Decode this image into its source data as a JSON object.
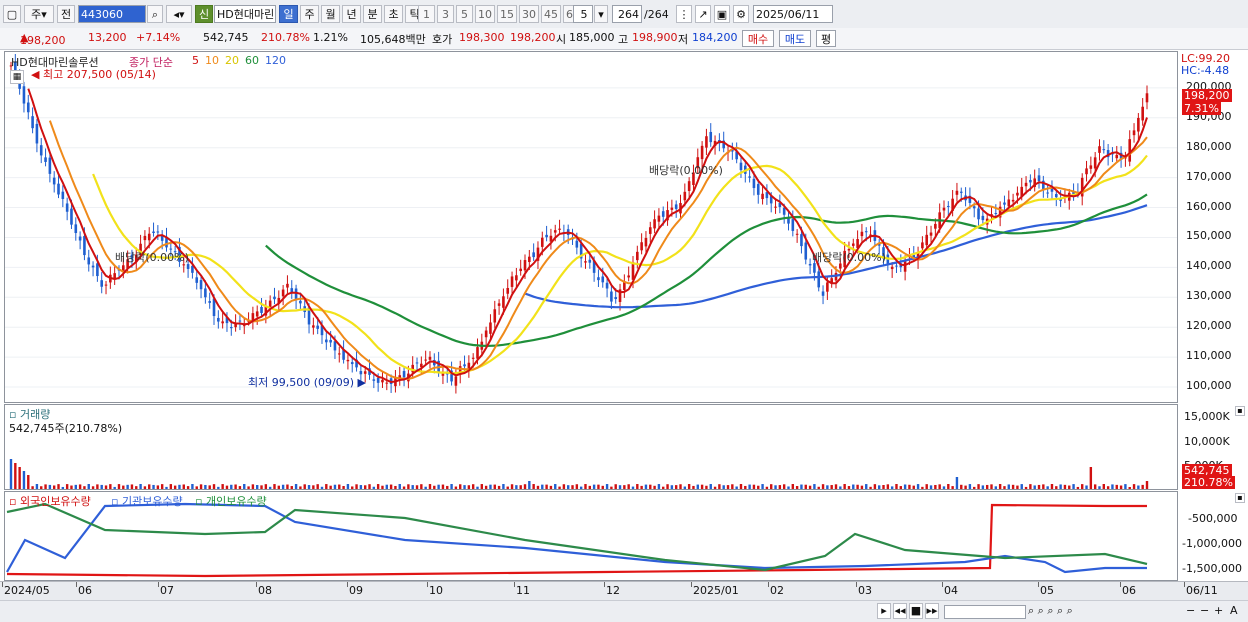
{
  "toolbar": {
    "period_type": "주",
    "prev_label": "전",
    "code": "443060",
    "new_badge": "신",
    "name": "HD현대마린",
    "periods": [
      "일",
      "주",
      "월",
      "년",
      "분",
      "초",
      "틱"
    ],
    "active_period": "일",
    "intervals": [
      "1",
      "3",
      "5",
      "10",
      "15",
      "30",
      "45",
      "60"
    ],
    "custom_interval": "5",
    "count": "264",
    "total": "/264",
    "date": "2025/06/11"
  },
  "info": {
    "price": "198,200",
    "change": "13,200",
    "change_pct": "+7.14%",
    "volume": "542,745",
    "volume_ratio": "210.78%",
    "turnover": "1.21%",
    "amount": "105,648백만",
    "ask_label": "호가",
    "ask": "198,300",
    "bid": "198,200",
    "open_label": "시",
    "open": "185,000",
    "high_label": "고",
    "high": "198,900",
    "low_label": "저",
    "low": "184,200",
    "buy_label": "매수",
    "sell_label": "매도",
    "eval_label": "평"
  },
  "legend": {
    "name": "HD현대마린솔루션",
    "ma_label": "종가 단순",
    "ma5": "5",
    "ma10": "10",
    "ma20": "20",
    "ma60": "60",
    "ma120": "120"
  },
  "annotations": {
    "high": "최고 207,500 (05/14)",
    "low": "최저 99,500 (09/09)",
    "div1": "배당락(0.00%)",
    "div2": "배당락(0.00%)",
    "div3": "배당락(0.00%)"
  },
  "right_info": {
    "lc": "LC:99.20",
    "hc": "HC:-4.48",
    "last": "198,200",
    "last_pct": "7.31%",
    "vol_last": "542,745",
    "vol_pct": "210.78%"
  },
  "volume_pane": {
    "title": "거래량",
    "summary": "542,745주(210.78%)"
  },
  "holding_pane": {
    "s1": "외국인보유수량",
    "s2": "기관보유수량",
    "s3": "개인보유수량"
  },
  "colors": {
    "ma5": "#d01010",
    "ma10": "#ef8a1a",
    "ma20": "#f2e21a",
    "ma60": "#1f8f3a",
    "ma120": "#2f5fd8",
    "up": "#d01010",
    "down": "#1f5fd0"
  },
  "chart_data": [
    {
      "type": "candlestick",
      "title": "HD현대마린솔루션",
      "x": [
        "2024/05",
        "06",
        "07",
        "08",
        "09",
        "10",
        "11",
        "12",
        "2025/01",
        "02",
        "03",
        "04",
        "05",
        "06",
        "06/11"
      ],
      "price_axis_ticks": [
        100000,
        110000,
        120000,
        130000,
        140000,
        150000,
        160000,
        170000,
        180000,
        190000,
        200000
      ],
      "price_axis_labels": [
        "100,000",
        "110,000",
        "120,000",
        "130,000",
        "140,000",
        "150,000",
        "160,000",
        "170,000",
        "180,000",
        "190,000",
        "200,000"
      ],
      "close_path": [
        207500,
        185000,
        165000,
        148000,
        133000,
        142000,
        152000,
        146000,
        135000,
        122000,
        120000,
        128000,
        133000,
        121000,
        112000,
        106000,
        100500,
        105000,
        109000,
        103000,
        110000,
        128000,
        140000,
        150000,
        152000,
        140000,
        128000,
        145000,
        158000,
        162000,
        185000,
        178000,
        168000,
        160000,
        150000,
        130000,
        146000,
        152000,
        140000,
        143000,
        158000,
        165000,
        155000,
        162000,
        170000,
        163000,
        166000,
        180000,
        176000,
        198200
      ],
      "ylim": [
        95000,
        212000
      ]
    },
    {
      "type": "bar",
      "title": "거래량",
      "y_axis_labels": [
        "5,000K",
        "10,000K",
        "15,000K"
      ]
    },
    {
      "type": "line",
      "series": [
        {
          "name": "외국인보유수량"
        },
        {
          "name": "기관보유수량"
        },
        {
          "name": "개인보유수량"
        }
      ],
      "y_axis_labels": [
        "-500,000",
        "-1,000,000",
        "-1,500,000"
      ]
    }
  ]
}
